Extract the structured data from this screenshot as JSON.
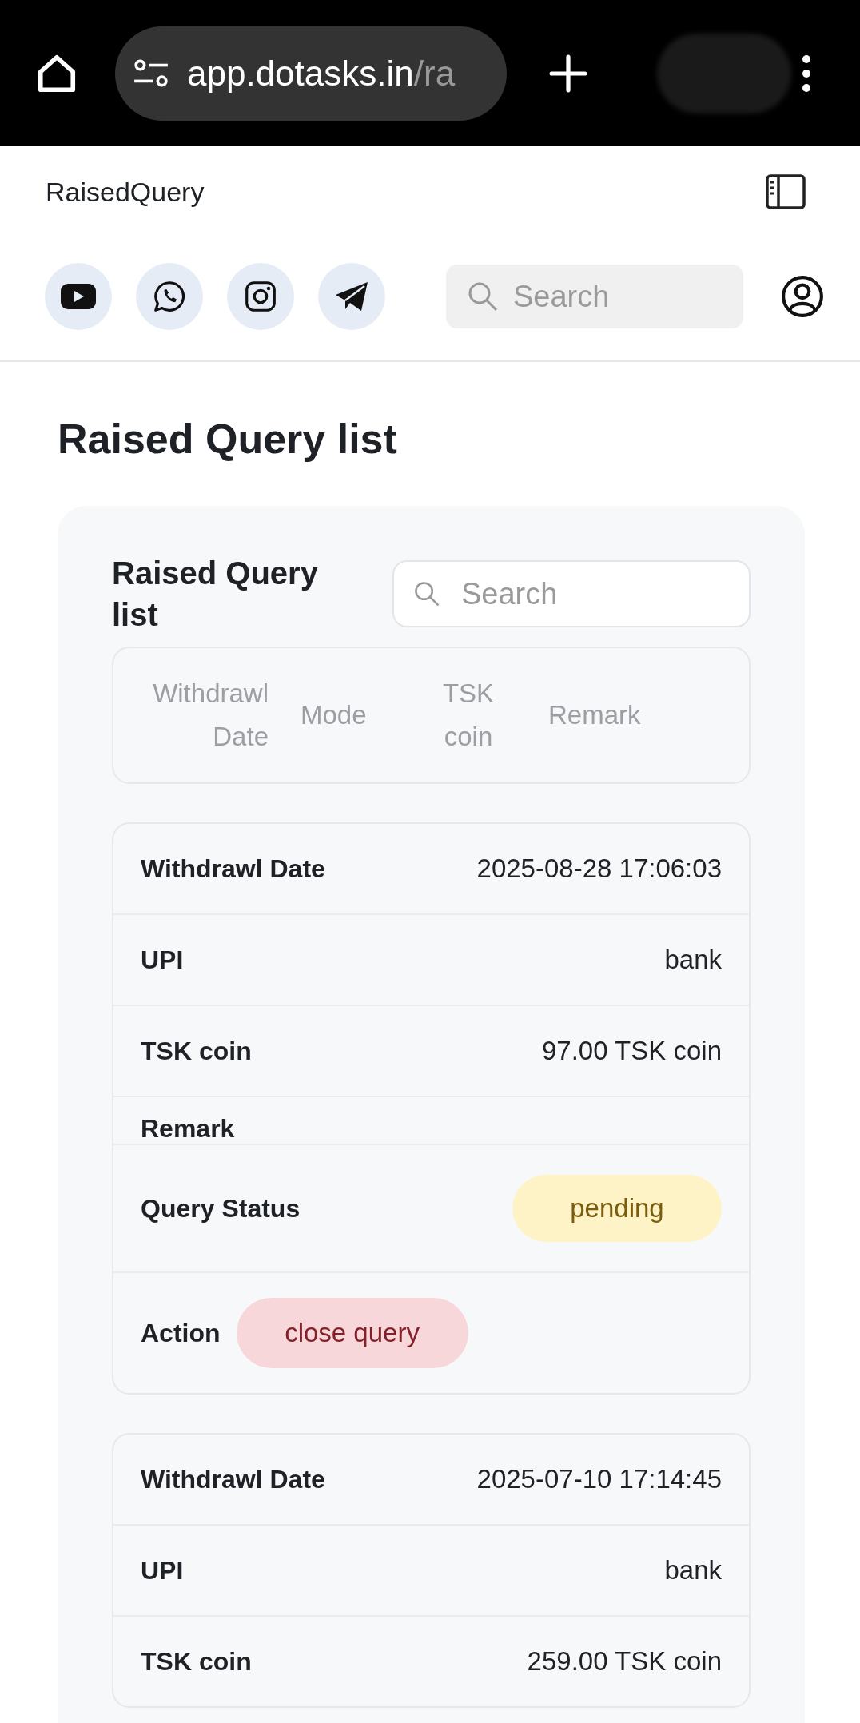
{
  "browser": {
    "url_host": "app.dotasks.in",
    "url_path": "/ra"
  },
  "header": {
    "title": "RaisedQuery",
    "search": {
      "placeholder": "Search"
    }
  },
  "page_title": "Raised Query list",
  "panel": {
    "title": "Raised Query list",
    "search": {
      "placeholder": "Search"
    },
    "columns": [
      "Withdrawl Date",
      "Mode",
      "TSK coin",
      "Remark"
    ],
    "records": [
      {
        "fields": [
          {
            "kind": "text",
            "label": "Withdrawl Date",
            "value": "2025-08-28 17:06:03"
          },
          {
            "kind": "text",
            "label": "UPI",
            "value": "bank"
          },
          {
            "kind": "text",
            "label": "TSK coin",
            "value": "97.00 TSK coin"
          },
          {
            "kind": "empty",
            "label": "Remark"
          },
          {
            "kind": "status",
            "label": "Query Status",
            "value": "pending"
          },
          {
            "kind": "action",
            "label": "Action",
            "value": "close query"
          }
        ]
      },
      {
        "fields": [
          {
            "kind": "text",
            "label": "Withdrawl Date",
            "value": "2025-07-10 17:14:45"
          },
          {
            "kind": "text",
            "label": "UPI",
            "value": "bank"
          },
          {
            "kind": "text",
            "label": "TSK coin",
            "value": "259.00 TSK coin"
          }
        ]
      }
    ]
  }
}
